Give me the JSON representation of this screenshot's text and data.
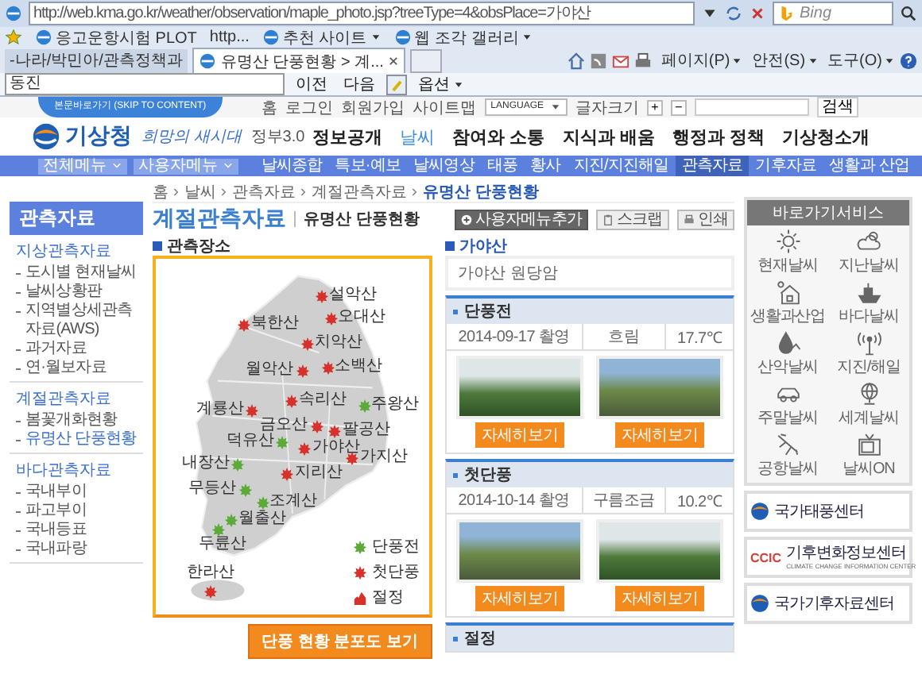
{
  "browser": {
    "address": "http://web.kma.go.kr/weather/observation/maple_photo.jsp?treeType=4&obsPlace=가야산",
    "search_placeholder": "Bing",
    "favorites": [
      {
        "label": "응고운항시험 PLOT",
        "icon": true,
        "dropdown": false
      },
      {
        "label": "http...",
        "icon": false,
        "dropdown": false
      },
      {
        "label": "추천 사이트",
        "icon": true,
        "dropdown": true
      },
      {
        "label": "웹 조각 갤러리",
        "icon": true,
        "dropdown": true
      }
    ],
    "tabs": [
      {
        "label": "-나라/박민아/관측정책과",
        "selected": false
      },
      {
        "label": "유명산 단풍현황 > 계...",
        "selected": true
      }
    ],
    "commands": [
      "페이지(P)",
      "안전(S)",
      "도구(O)"
    ],
    "find": {
      "value": "동진",
      "buttons": [
        "이전",
        "다음"
      ],
      "options": "옵션"
    }
  },
  "site": {
    "skip": "본문바로가기 (SKIP TO CONTENT)",
    "util_links": [
      "홈",
      "로그인",
      "회원가입",
      "사이트맵"
    ],
    "language": "LANGUAGE",
    "font_size": "글자크기",
    "font_buttons": [
      "+",
      "−"
    ],
    "search_button": "검색",
    "logo": "기상청",
    "slogan": "희망의 새시대",
    "gov_prefix": "정부3.0",
    "gov_link": "정보공개",
    "nav": [
      {
        "label": "날씨",
        "selected": true
      },
      {
        "label": "참여와 소통",
        "selected": false
      },
      {
        "label": "지식과 배움",
        "selected": false
      },
      {
        "label": "행정과 정책",
        "selected": false
      },
      {
        "label": "기상청소개",
        "selected": false
      }
    ],
    "menu_buttons": [
      "전체메뉴",
      "사용자메뉴"
    ],
    "menu": [
      {
        "label": "날씨종합",
        "selected": false
      },
      {
        "label": "특보·예보",
        "selected": false
      },
      {
        "label": "날씨영상",
        "selected": false
      },
      {
        "label": "태풍",
        "selected": false
      },
      {
        "label": "황사",
        "selected": false
      },
      {
        "label": "지진/지진해일",
        "selected": false
      },
      {
        "label": "관측자료",
        "selected": true
      },
      {
        "label": "기후자료",
        "selected": false
      },
      {
        "label": "생활과 산업",
        "selected": false
      }
    ]
  },
  "sidebar": {
    "title": "관측자료",
    "groups": [
      {
        "label": "지상관측자료",
        "items": [
          {
            "label": "도시별 현재날씨",
            "selected": false
          },
          {
            "label": "날씨상황판",
            "selected": false
          },
          {
            "label": "지역별상세관측자료(AWS)",
            "selected": false
          },
          {
            "label": "과거자료",
            "selected": false
          },
          {
            "label": "연·월보자료",
            "selected": false
          }
        ]
      },
      {
        "label": "계절관측자료",
        "items": [
          {
            "label": "봄꽃개화현황",
            "selected": false
          },
          {
            "label": "유명산 단풍현황",
            "selected": true
          }
        ]
      },
      {
        "label": "바다관측자료",
        "items": [
          {
            "label": "국내부이",
            "selected": false
          },
          {
            "label": "파고부이",
            "selected": false
          },
          {
            "label": "국내등표",
            "selected": false
          },
          {
            "label": "국내파랑",
            "selected": false
          }
        ]
      }
    ]
  },
  "breadcrumb": [
    "홈",
    "날씨",
    "관측자료",
    "계절관측자료",
    "유명산 단풍현황"
  ],
  "title": "계절관측자료",
  "subtitle": "유명산 단풍현황",
  "tools": [
    {
      "label": "사용자메뉴추가",
      "kind": "add"
    },
    {
      "label": "스크랩",
      "kind": "scrap"
    },
    {
      "label": "인쇄",
      "kind": "print"
    }
  ],
  "map": {
    "heading": "관측장소",
    "places": [
      {
        "name": "설악산",
        "color": "#d6312b"
      },
      {
        "name": "북한산",
        "color": "#d6312b"
      },
      {
        "name": "오대산",
        "color": "#d6312b"
      },
      {
        "name": "치악산",
        "color": "#d6312b"
      },
      {
        "name": "월악산",
        "color": "#d6312b"
      },
      {
        "name": "소백산",
        "color": "#d6312b"
      },
      {
        "name": "계룡산",
        "color": "#d6312b"
      },
      {
        "name": "속리산",
        "color": "#d6312b"
      },
      {
        "name": "주왕산",
        "color": "#5cab3a"
      },
      {
        "name": "금오산",
        "color": "#d6312b"
      },
      {
        "name": "팔공산",
        "color": "#d6312b"
      },
      {
        "name": "덕유산",
        "color": "#5cab3a"
      },
      {
        "name": "가야산",
        "color": "#d6312b"
      },
      {
        "name": "가지산",
        "color": "#d6312b"
      },
      {
        "name": "내장산",
        "color": "#5cab3a"
      },
      {
        "name": "지리산",
        "color": "#d6312b"
      },
      {
        "name": "무등산",
        "color": "#5cab3a"
      },
      {
        "name": "조계산",
        "color": "#5cab3a"
      },
      {
        "name": "월출산",
        "color": "#5cab3a"
      },
      {
        "name": "두륜산",
        "color": "#5cab3a"
      },
      {
        "name": "한라산",
        "color": "#d6312b"
      }
    ],
    "legend": [
      {
        "label": "단풍전",
        "kind": "leaf",
        "color": "#5cab3a"
      },
      {
        "label": "첫단풍",
        "kind": "leaf",
        "color": "#d6312b"
      },
      {
        "label": "절정",
        "kind": "peak",
        "color": "#d6312b"
      }
    ],
    "button": "단풍 현황 분포도 보기"
  },
  "station": {
    "name": "가야산",
    "location": "가야산 원당암",
    "sections": [
      {
        "title": "단풍전",
        "date": "2014-09-17 촬영",
        "weather": "흐림",
        "temp": "17.7℃",
        "photos": [
          {
            "button": "자세히보기"
          },
          {
            "button": "자세히보기"
          }
        ]
      },
      {
        "title": "첫단풍",
        "date": "2014-10-14 촬영",
        "weather": "구름조금",
        "temp": "10.2℃",
        "photos": [
          {
            "button": "자세히보기"
          },
          {
            "button": "자세히보기"
          }
        ]
      },
      {
        "title": "절정"
      }
    ]
  },
  "quick": {
    "title": "바로가기서비스",
    "items": [
      {
        "label": "현재날씨",
        "kind": "sun"
      },
      {
        "label": "지난날씨",
        "kind": "cloud"
      },
      {
        "label": "생활과산업",
        "kind": "house"
      },
      {
        "label": "바다날씨",
        "kind": "ship"
      },
      {
        "label": "산악날씨",
        "kind": "drop"
      },
      {
        "label": "지진/해일",
        "kind": "antenna"
      },
      {
        "label": "주말날씨",
        "kind": "car"
      },
      {
        "label": "세계날씨",
        "kind": "globe"
      },
      {
        "label": "공항날씨",
        "kind": "plane"
      },
      {
        "label": "날씨ON",
        "kind": "tv"
      }
    ],
    "banners": [
      {
        "label": "국가태풍센터",
        "kind": "swirl"
      },
      {
        "label": "기후변화정보센터",
        "kind": "ccic",
        "mark": "CCIC",
        "caption": "CLIMATE CHANGE INFORMATION CENTER"
      },
      {
        "label": "국가기후자료센터",
        "kind": "swirl"
      }
    ]
  }
}
